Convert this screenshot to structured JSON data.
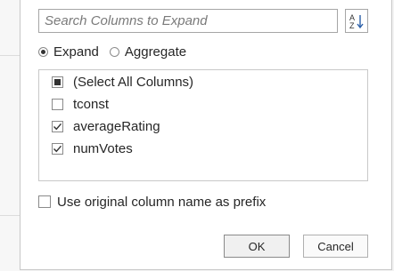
{
  "search": {
    "placeholder": "Search Columns to Expand",
    "value": ""
  },
  "sort_button": {
    "icon": "sort-a-z-icon",
    "glyph_top": "A",
    "glyph_bottom": "Z"
  },
  "mode": {
    "options": [
      {
        "label": "Expand",
        "selected": true
      },
      {
        "label": "Aggregate",
        "selected": false
      }
    ]
  },
  "columns": {
    "items": [
      {
        "label": "(Select All Columns)",
        "state": "partial"
      },
      {
        "label": "tconst",
        "state": "unchecked"
      },
      {
        "label": "averageRating",
        "state": "checked"
      },
      {
        "label": "numVotes",
        "state": "checked"
      }
    ]
  },
  "prefix": {
    "label": "Use original column name as prefix",
    "checked": false
  },
  "buttons": {
    "ok": "OK",
    "cancel": "Cancel"
  },
  "colors": {
    "accent": "#8a8a8a",
    "text": "#262626",
    "check": "#333333"
  }
}
